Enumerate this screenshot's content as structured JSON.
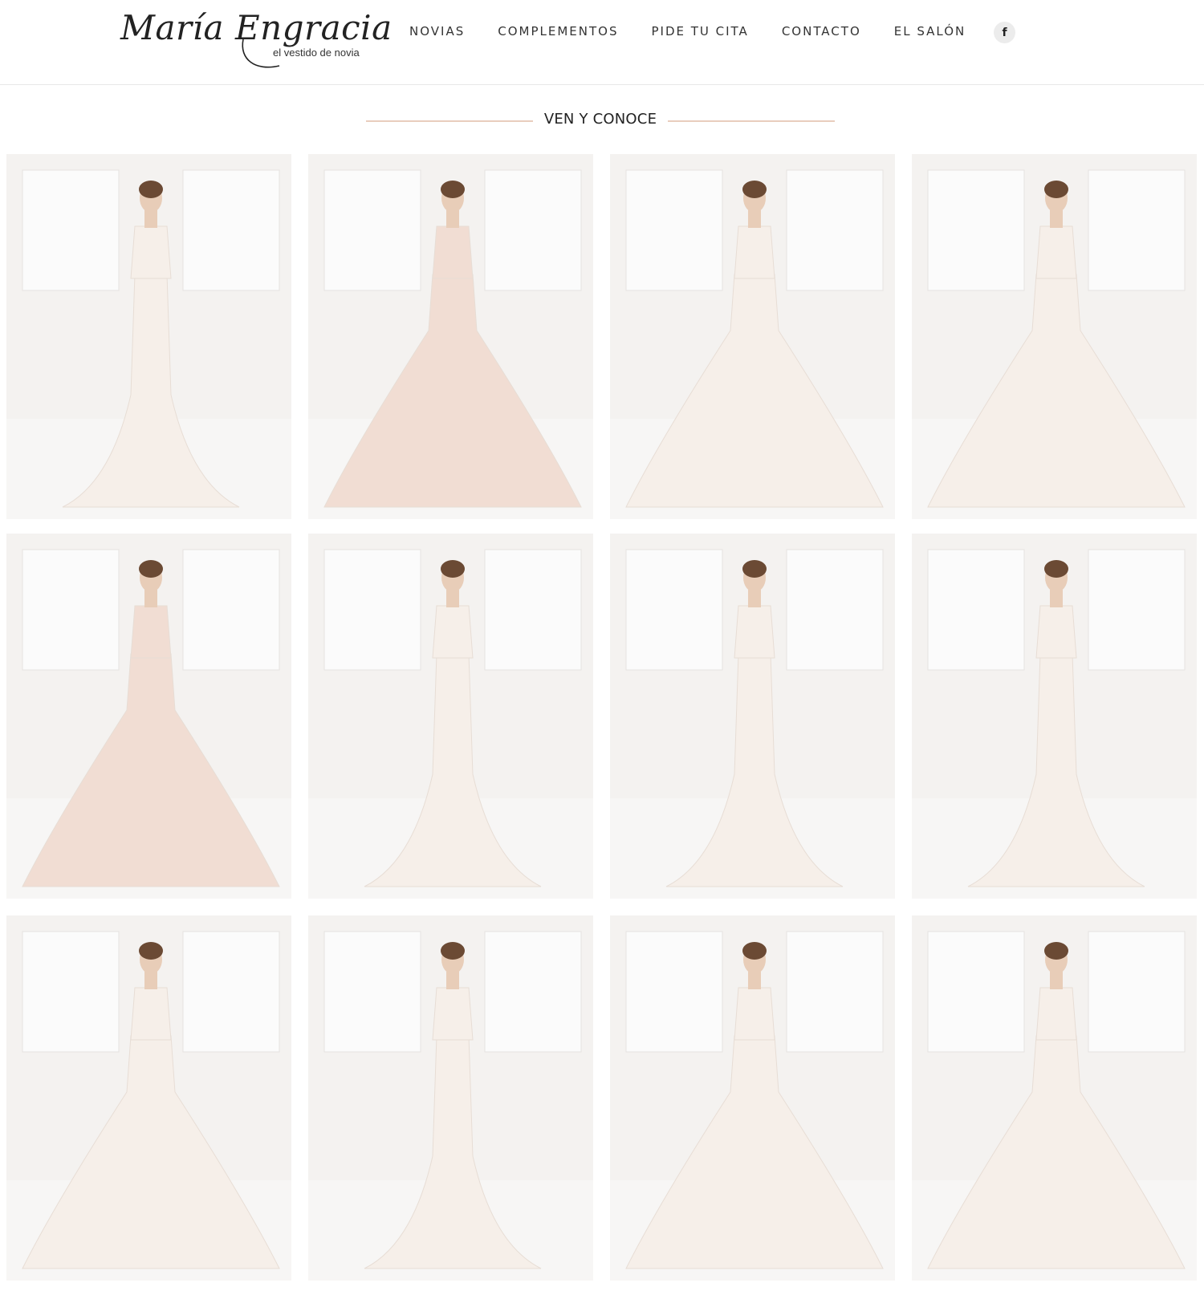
{
  "header": {
    "logo_script": "María Engracia",
    "logo_tagline": "el vestido de novia",
    "nav": [
      "NOVIAS",
      "COMPLEMENTOS",
      "PIDE TU CITA",
      "CONTACTO",
      "EL SALÓN"
    ],
    "social_icon": "facebook-icon",
    "social_glyph": "f"
  },
  "section": {
    "title": "VEN Y CONOCE"
  },
  "gallery": {
    "tiles": [
      {
        "dress": "mermaid-lace-back"
      },
      {
        "dress": "a-line-blush-lace"
      },
      {
        "dress": "ballgown-long-sleeve"
      },
      {
        "dress": "ballgown-illusion"
      },
      {
        "dress": "ballgown-blush-bow"
      },
      {
        "dress": "mermaid-lace-back"
      },
      {
        "dress": "mermaid-long-sleeve"
      },
      {
        "dress": "mermaid-lace-back"
      },
      {
        "dress": "tiered-ruffle-ballgown"
      },
      {
        "dress": "satin-mermaid-back"
      },
      {
        "dress": "lace-ballgown-back"
      },
      {
        "dress": "lace-a-line-front"
      }
    ]
  },
  "colors": {
    "accent_line": "#e9cdbd",
    "dress_ivory": "#f6efe9",
    "dress_blush": "#f1ddd3",
    "room": "#f4f2f0"
  }
}
